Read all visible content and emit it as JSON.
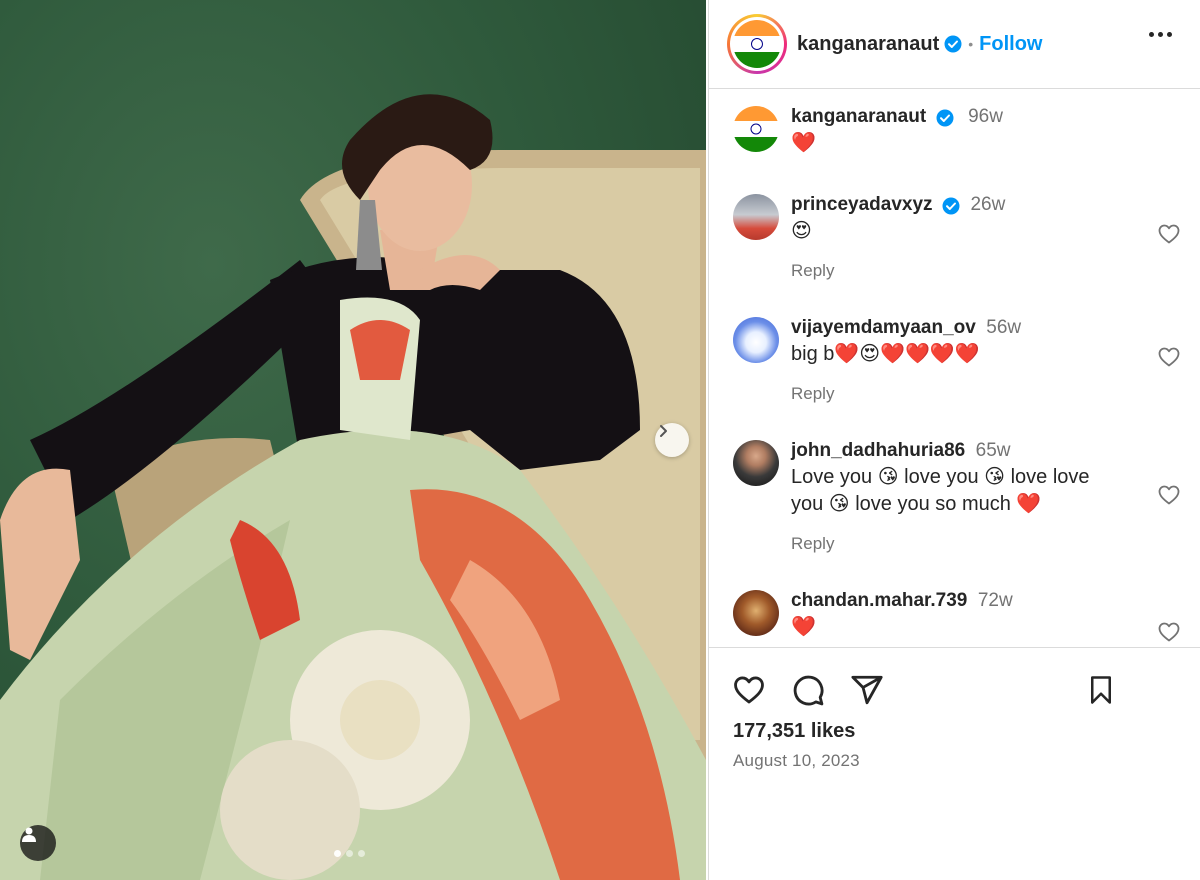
{
  "post": {
    "username": "kanganaranaut",
    "separator": "•",
    "follow_label": "Follow",
    "likes": "177,351 likes",
    "date": "August 10, 2023"
  },
  "carousel": {
    "total_slides": 3,
    "active_slide": 1
  },
  "comments": [
    {
      "username": "kanganaranaut",
      "verified": true,
      "time": "96w",
      "text": "❤️",
      "reply": ""
    },
    {
      "username": "princeyadavxyz",
      "verified": true,
      "time": "26w",
      "text": "😍",
      "reply": "Reply"
    },
    {
      "username": "vijayemdamyaan_ov",
      "verified": false,
      "time": "56w",
      "text": "big b❤️😍❤️❤️❤️❤️",
      "reply": "Reply"
    },
    {
      "username": "john_dadhahuria86",
      "verified": false,
      "time": "65w",
      "text": "Love you 😘 love you 😘 love love you 😘 love you so much ❤️",
      "reply": "Reply"
    },
    {
      "username": "chandan.mahar.739",
      "verified": false,
      "time": "72w",
      "text": "❤️",
      "reply": ""
    }
  ],
  "colors": {
    "accent": "#0095f6",
    "verified": "#0095f6",
    "muted": "#737373",
    "text": "#262626"
  },
  "icons": [
    "more-icon",
    "verified-icon",
    "heart-icon",
    "comment-icon",
    "share-icon",
    "bookmark-icon",
    "chevron-right-icon",
    "user-tag-icon"
  ]
}
